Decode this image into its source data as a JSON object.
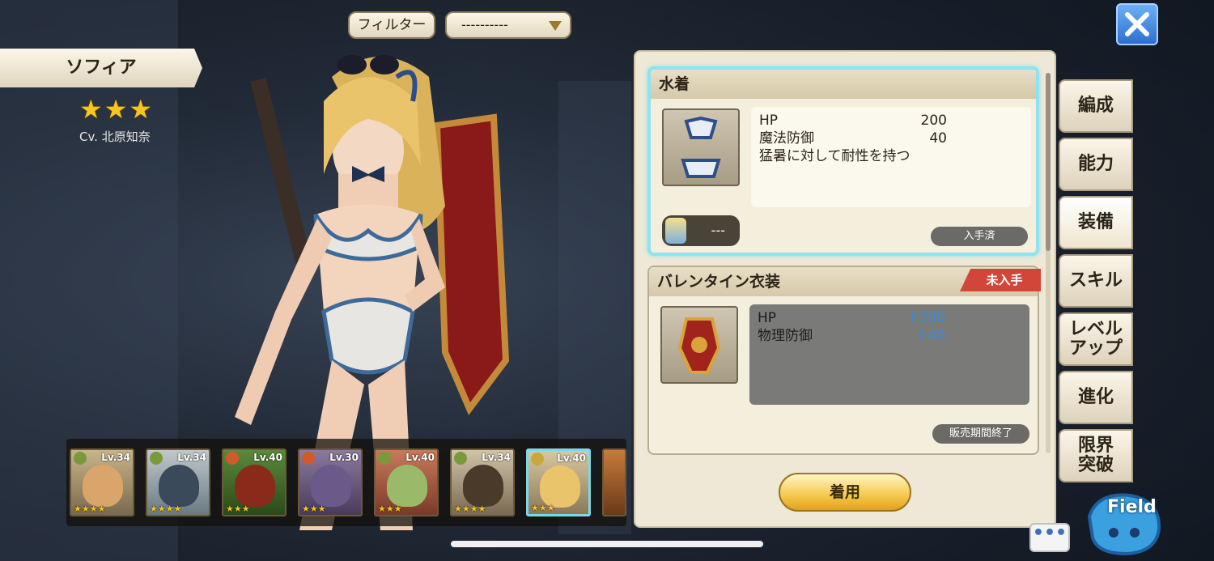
{
  "filter": {
    "button_label": "フィルター",
    "select_value": "----------"
  },
  "character": {
    "name": "ソフィア",
    "stars": "★★★",
    "cv": "Cv. 北原知奈"
  },
  "party": [
    {
      "level": "Lv.34",
      "stars": "★★★★"
    },
    {
      "level": "Lv.34",
      "stars": "★★★★"
    },
    {
      "level": "Lv.40",
      "stars": "★★★"
    },
    {
      "level": "Lv.30",
      "stars": "★★★"
    },
    {
      "level": "Lv.40",
      "stars": "★★★"
    },
    {
      "level": "Lv.34",
      "stars": "★★★★"
    },
    {
      "level": "Lv.40",
      "stars": "★★★"
    }
  ],
  "costumes": [
    {
      "title": "水着",
      "stats": [
        {
          "label": "HP",
          "value": "200"
        },
        {
          "label": "魔法防御",
          "value": "40"
        }
      ],
      "description": "猛暑に対して耐性を持つ",
      "owner": "---",
      "status": "入手済"
    },
    {
      "title": "バレンタイン衣装",
      "ribbon": "未入手",
      "stats": [
        {
          "label": "HP",
          "value": "200"
        },
        {
          "label": "物理防御",
          "value": "40"
        }
      ],
      "status": "販売期間終了"
    }
  ],
  "equip_button": "着用",
  "tabs": [
    "編成",
    "能力",
    "装備",
    "スキル",
    "レベル\nアップ",
    "進化",
    "限界\n突破"
  ],
  "field_label": "Field",
  "chat_label": "•••",
  "colors": {
    "accent_blue": "#3a8ae0",
    "highlight": "#8fe2f0",
    "ribbon": "#d2463a"
  }
}
